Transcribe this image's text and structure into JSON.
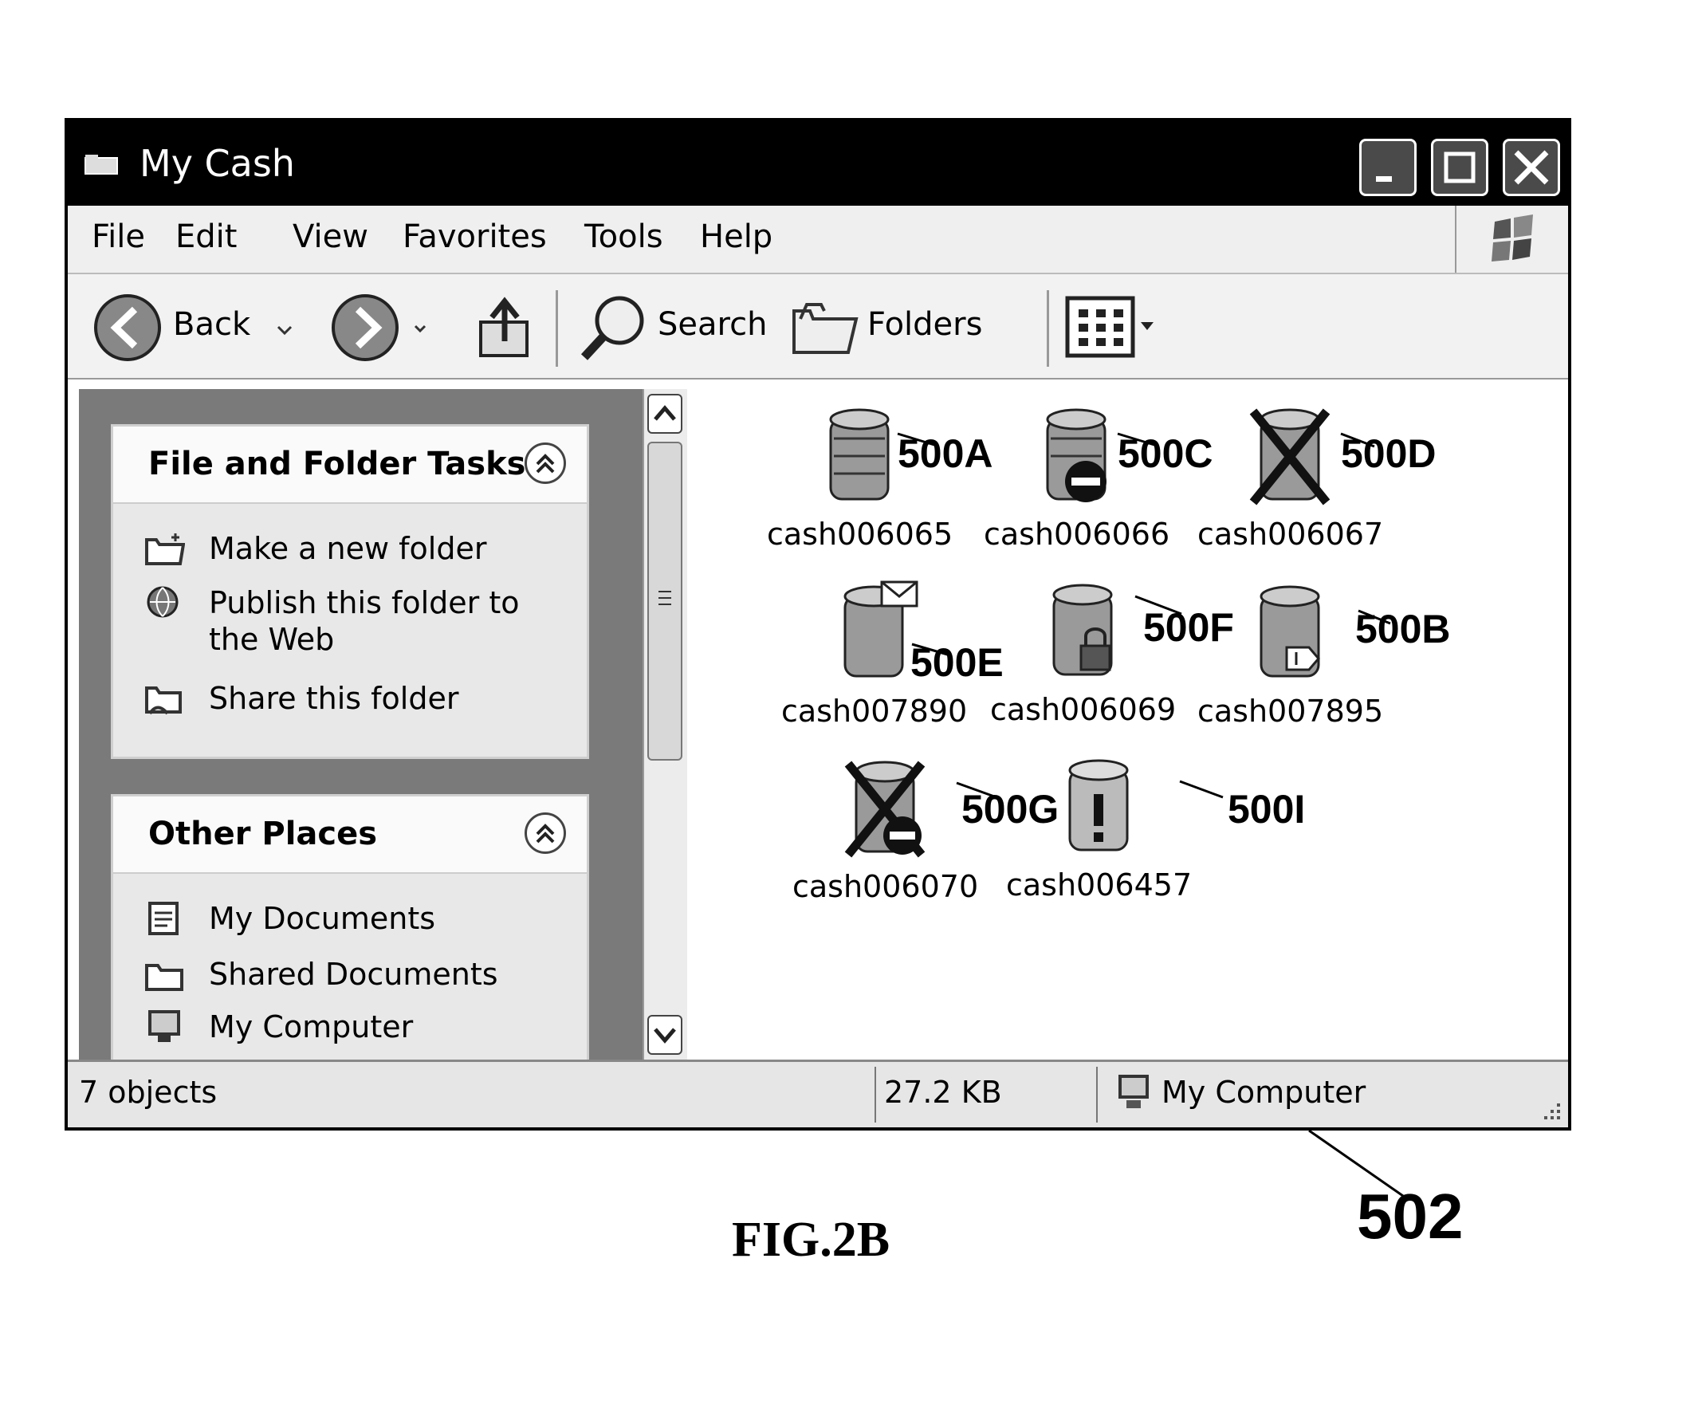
{
  "window": {
    "title": "My Cash",
    "title_icon": "folder-icon",
    "controls": [
      "minimize",
      "maximize",
      "close"
    ]
  },
  "menu": {
    "items": [
      "File",
      "Edit",
      "View",
      "Favorites",
      "Tools",
      "Help"
    ]
  },
  "toolbar": {
    "back_label": "Back",
    "search_label": "Search",
    "folders_label": "Folders"
  },
  "tasks_panel": {
    "title": "File and Folder Tasks",
    "items": [
      "Make a new folder",
      "Publish this folder to the Web",
      "Share this folder"
    ]
  },
  "places_panel": {
    "title": "Other Places",
    "items": [
      "My Documents",
      "Shared Documents",
      "My Computer"
    ]
  },
  "files": [
    {
      "name": "cash006065",
      "ref": "500A",
      "overlay": "none"
    },
    {
      "name": "cash006066",
      "ref": "500C",
      "overlay": "minus-badge"
    },
    {
      "name": "cash006067",
      "ref": "500D",
      "overlay": "x-cross"
    },
    {
      "name": "cash007890",
      "ref": "500E",
      "overlay": "envelope"
    },
    {
      "name": "cash006069",
      "ref": "500F",
      "overlay": "lock"
    },
    {
      "name": "cash007895",
      "ref": "500B",
      "overlay": "arrow-tag"
    },
    {
      "name": "cash006070",
      "ref": "500G",
      "overlay": "x-cross-minus"
    },
    {
      "name": "cash006457",
      "ref": "500I",
      "overlay": "exclamation"
    }
  ],
  "status": {
    "objects": "7 objects",
    "size": "27.2 KB",
    "location": "My Computer"
  },
  "figure": {
    "caption": "FIG.2B",
    "ref": "502"
  }
}
